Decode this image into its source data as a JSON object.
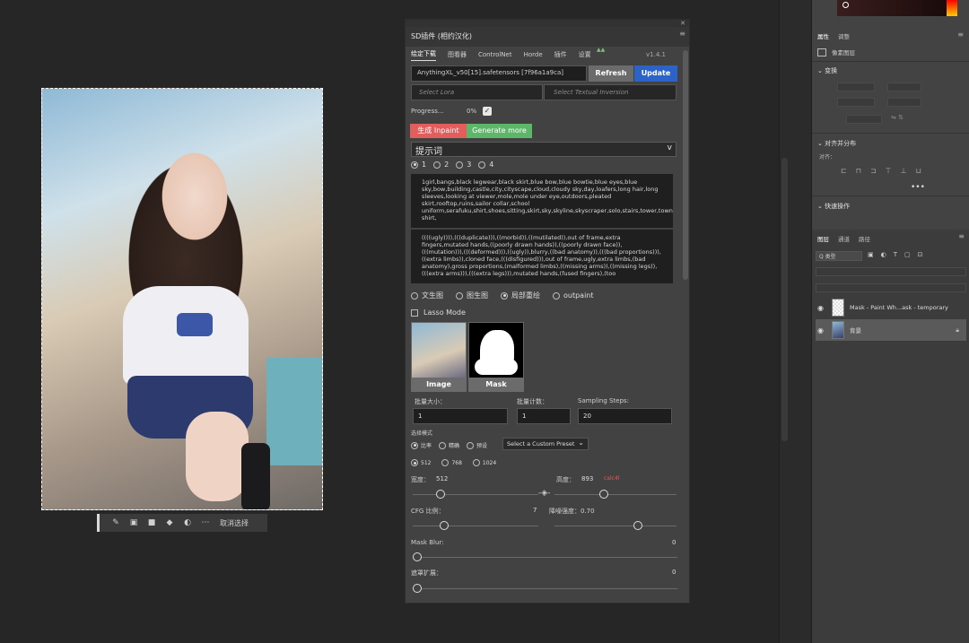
{
  "context_bar": {
    "icons": [
      "brush-icon",
      "invert-selection-icon",
      "mask-icon",
      "fill-icon",
      "adjust-icon",
      "more-icon"
    ],
    "cancel_label": "取消选择"
  },
  "sd_panel": {
    "title": "SD插件 (相约汉化)",
    "tabs": [
      "绘定下载",
      "图看器",
      "ControlNet",
      "Horde",
      "插件",
      "设置"
    ],
    "version": "v1.4.1",
    "model": "AnythingXL_v50[15].safetensors [7f96a1a9ca]",
    "refresh_label": "Refresh",
    "update_label": "Update",
    "lora_placeholder": "Select Lora",
    "ti_placeholder": "Select Textual Inversion",
    "progress_label": "Progress...",
    "progress_value": "0%",
    "generate_inpaint_label": "生成 Inpaint",
    "generate_more_label": "Generate more",
    "prompt_preset": "提示词",
    "prompt_slots": [
      "1",
      "2",
      "3",
      "4"
    ],
    "positive_prompt": "1girl,bangs,black legwear,black skirt,blue bow,blue bowtie,blue eyes,blue sky,bow,building,castle,city,cityscape,cloud,cloudy sky,day,loafers,long hair,long sleeves,looking at viewer,mole,mole under eye,outdoors,pleated skirt,rooftop,ruins,sailor collar,school uniform,serafuku,shirt,shoes,sitting,skirt,sky,skyline,skyscraper,solo,stairs,tower,town,white shirt,",
    "negative_prompt": "((((ugly)))),(((duplicate))),((morbid)),((mutilated)),out of frame,extra fingers,mutated hands,((poorly drawn hands)),((poorly drawn face)),(((mutation))),(((deformed))),((ugly)),blurry,((bad anatomy)),(((bad proportions))),((extra limbs)),cloned face,(((disfigured))),out of frame,ugly,extra limbs,(bad anatomy),gross proportions,(malformed limbs),((missing arms)),((missing legs)),(((extra arms))),(((extra legs))),mutated hands,(fused fingers),(too",
    "modes": [
      "文生图",
      "图生图",
      "局部重绘",
      "outpaint"
    ],
    "selected_mode": "局部重绘",
    "lasso_label": "Lasso Mode",
    "image_label": "Image",
    "mask_label": "Mask",
    "batch_size_label": "批量大小：",
    "batch_size": "1",
    "batch_count_label": "批量计数：",
    "batch_count": "1",
    "steps_label": "Sampling Steps:",
    "steps": "20",
    "scale_label": "选择模式",
    "scale_options": [
      "比率",
      "精确",
      "预设"
    ],
    "preset_label": "Select a Custom Preset",
    "size_options": [
      "512",
      "768",
      "1024"
    ],
    "width_label": "宽度：",
    "width_value": "512",
    "height_label": "高度：",
    "height_value": "893",
    "calc_label": "calc4l",
    "cfg_label": "CFG 比例：",
    "cfg_value": "7",
    "denoise_label": "降噪强度：0.70",
    "mask_blur_label": "Mask Blur:",
    "mask_blur_value": "0",
    "expand_label": "遮罩扩展：",
    "expand_value": "0",
    "sliders": {
      "width": 0.2,
      "height": 0.4,
      "cfg": 0.23,
      "denoise": 0.7,
      "mask_blur": 0,
      "expand": 0
    }
  },
  "right_dock": {
    "props_tabs": [
      "属性",
      "调整"
    ],
    "pixel_layer": "像素图层",
    "transform_head": "变换",
    "align_head": "对齐并分布",
    "align_label": "对齐：",
    "quick_head": "快速操作",
    "layers_tabs": [
      "图层",
      "通道",
      "路径"
    ],
    "filter_label": "Q 类型",
    "layers": [
      {
        "name": "Mask - Paint Wh...ask - temporary",
        "visible": true,
        "locked": false
      },
      {
        "name": "背景",
        "visible": true,
        "locked": true
      }
    ]
  },
  "colors": {
    "refresh": "#6b6b6b",
    "update": "#2b63c9",
    "inpaint": "#e35d5d",
    "generate_more": "#5db768",
    "calc": "#e05a5a"
  }
}
